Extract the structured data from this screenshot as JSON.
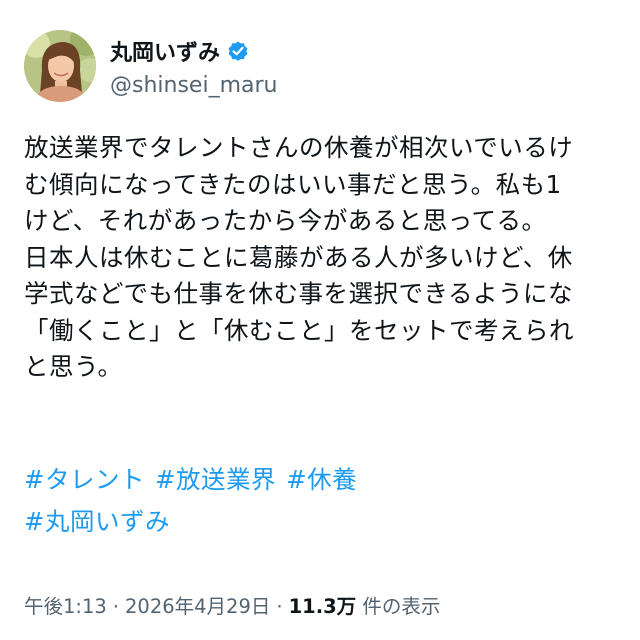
{
  "author": {
    "display_name": "丸岡いずみ",
    "handle": "@shinsei_maru",
    "verified_badge_color": "#1d9bf0",
    "avatar_icon": "profile-photo"
  },
  "tweet": {
    "lines": [
      "放送業界でタレントさんの休養が相次いでいるけ",
      "む傾向になってきたのはいい事だと思う。私も1",
      "けど、それがあったから今があると思ってる。",
      "日本人は休むことに葛藤がある人が多いけど、休",
      "学式などでも仕事を休む事を選択できるようにな",
      "「働くこと」と「休むこと」をセットで考えられ",
      "と思う。"
    ],
    "hashtags_row1": [
      "#タレント",
      "#放送業界",
      "#休養"
    ],
    "hashtags_row2": [
      "#丸岡いずみ"
    ]
  },
  "meta": {
    "time": "午後1:13",
    "date": "2026年4月29日",
    "separator": "·",
    "views": "11.3万",
    "views_label": "件の表示"
  },
  "colors": {
    "text": "#0f1419",
    "secondary": "#536471",
    "link": "#1d9bf0"
  }
}
